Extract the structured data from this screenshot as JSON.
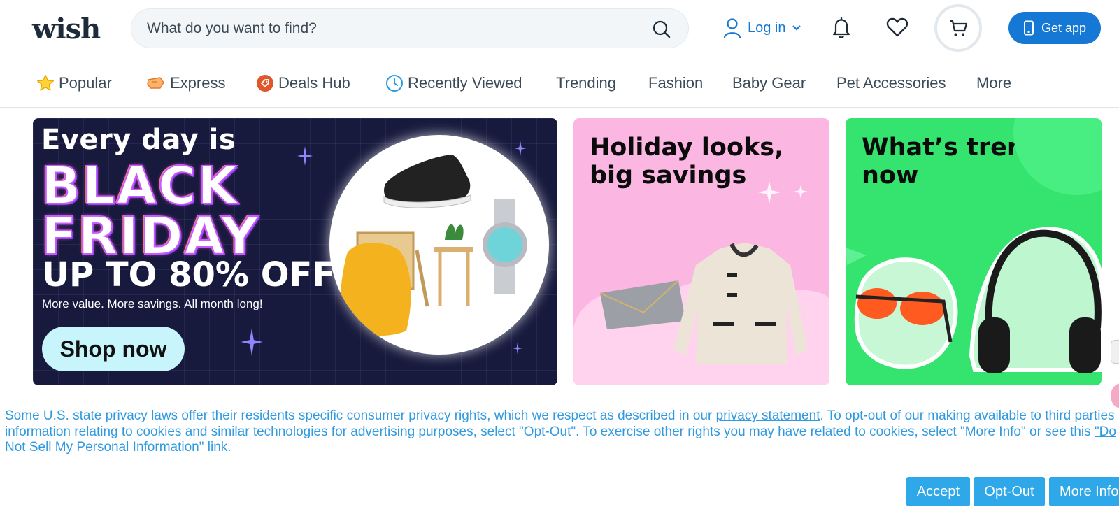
{
  "header": {
    "logo": "wish",
    "search_placeholder": "What do you want to find?",
    "login_label": "Log in",
    "get_app_label": "Get app",
    "icons": [
      "search-icon",
      "user-icon",
      "chevron-down-icon",
      "bell-icon",
      "heart-icon",
      "cart-icon",
      "phone-icon"
    ]
  },
  "nav": {
    "items": [
      {
        "label": "Popular",
        "icon": "star-icon"
      },
      {
        "label": "Express",
        "icon": "express-icon"
      },
      {
        "label": "Deals Hub",
        "icon": "tag-icon"
      },
      {
        "label": "Recently Viewed",
        "icon": "clock-icon"
      },
      {
        "label": "Trending"
      },
      {
        "label": "Fashion"
      },
      {
        "label": "Baby Gear"
      },
      {
        "label": "Pet Accessories"
      },
      {
        "label": "More"
      }
    ]
  },
  "banners": {
    "black_friday": {
      "line1": "Every day is",
      "line2": "BLACK",
      "line3": "FRIDAY",
      "offer": "UP TO 80% OFF",
      "subtext": "More value. More savings. All month long!",
      "cta": "Shop now"
    },
    "holiday": {
      "title_line1": "Holiday looks,",
      "title_line2": "big savings"
    },
    "trending": {
      "title_line1": "What’s trending",
      "title_line2": "now"
    }
  },
  "consent": {
    "text_part1": "Some U.S. state privacy laws offer their residents specific consumer privacy rights, which we respect as described in our ",
    "link1": "privacy statement",
    "text_part2": ". To opt-out of our making available to third parties information relating to cookies and similar technologies for advertising purposes, select \"Opt-Out\". To exercise other rights you may have related to cookies, select \"More Info\" or see this ",
    "link2": "\"Do Not Sell My Personal Information\"",
    "text_part3": " link.",
    "accept_label": "Accept",
    "optout_label": "Opt-Out",
    "moreinfo_label": "More Info"
  },
  "colors": {
    "brand_blue": "#1478d4",
    "consent_blue": "#2ea8e8",
    "banner_dark": "#171a3d",
    "banner_pink": "#fbb6e2",
    "banner_green": "#34e46f"
  }
}
